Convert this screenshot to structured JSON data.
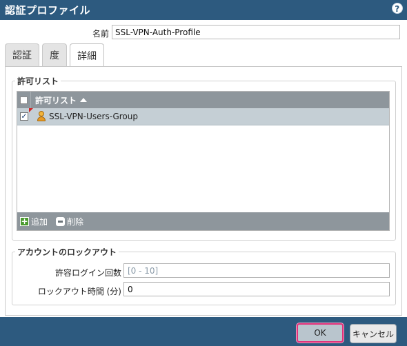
{
  "dialog": {
    "title": "認証プロファイル",
    "help_glyph": "?"
  },
  "name_field": {
    "label": "名前",
    "value": "SSL-VPN-Auth-Profile"
  },
  "tabs": [
    {
      "label": "認証",
      "active": false
    },
    {
      "label": "度",
      "active": false
    },
    {
      "label": "詳細",
      "active": true
    }
  ],
  "allow_list": {
    "legend": "許可リスト",
    "column_header": "許可リスト",
    "sort": "ascending",
    "rows": [
      {
        "name": "SSL-VPN-Users-Group",
        "checked": true,
        "icon": "user-group-icon"
      }
    ],
    "add_label": "追加",
    "delete_label": "削除"
  },
  "lockout": {
    "legend": "アカウントのロックアウト",
    "attempts_label": "許容ログイン回数",
    "attempts_value": "",
    "attempts_placeholder": "[0 - 10]",
    "lockout_time_label": "ロックアウト時間 (分)",
    "lockout_time_value": "0"
  },
  "buttons": {
    "ok_label": "OK",
    "cancel_label": "キャンセル"
  },
  "colors": {
    "titlebar": "#2d5a7f",
    "grid_header": "#8e969c",
    "selected_row": "#c5cfd5",
    "ok_focus_border": "#e0307a"
  }
}
